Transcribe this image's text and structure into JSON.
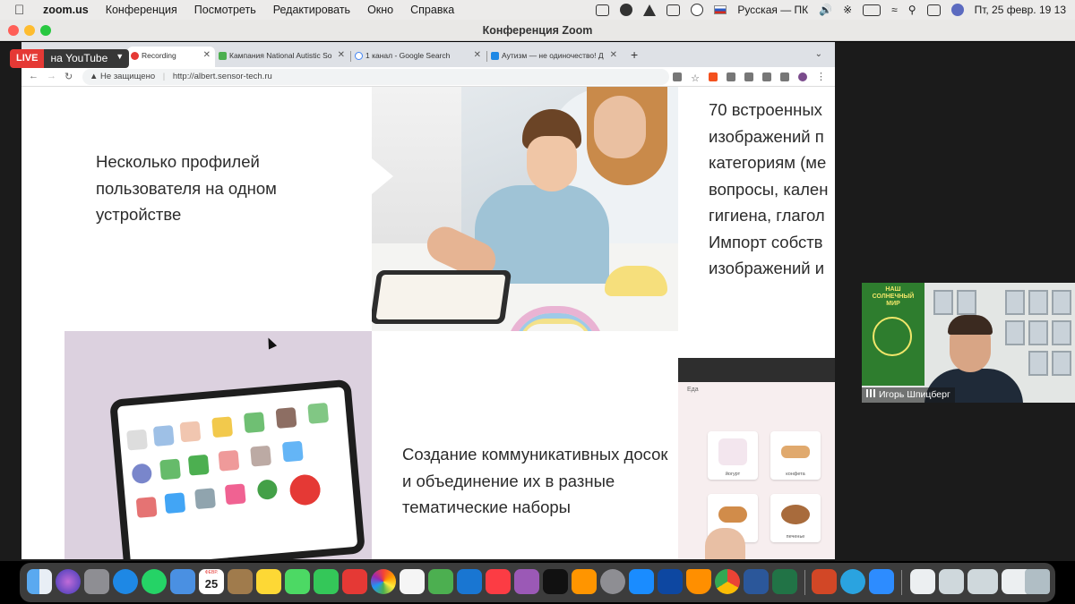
{
  "menubar": {
    "app_name": "zoom.us",
    "items": [
      "Конференция",
      "Посмотреть",
      "Редактировать",
      "Окно",
      "Справка"
    ],
    "input_source": "Русская — ПК",
    "datetime": "Пт, 25 февр.  19 13"
  },
  "zoom_window": {
    "title": "Конференция Zoom"
  },
  "live_badge": {
    "live": "LIVE",
    "target": "на YouTube"
  },
  "browser": {
    "tabs": [
      {
        "label": "Recording",
        "color": "#e53935"
      },
      {
        "label": "Кампания National Autistic So",
        "color": "#4caf50"
      },
      {
        "label": "1 канал - Google Search",
        "color": "#4285f4"
      },
      {
        "label": "Аутизм — не одиночество! Д",
        "color": "#1e88e5"
      }
    ],
    "security": "Не защищено",
    "url": "http://albert.sensor-tech.ru"
  },
  "page": {
    "profiles_text": "Несколько профилей пользователя на одном устройстве",
    "images_lines": [
      "70 встроенных",
      "изображений п",
      "категориям (ме",
      "вопросы, кален",
      "гигиена, глагол",
      "Импорт собств",
      "изображений и"
    ],
    "boards_text": "Создание коммуникативных досок и объединение их в разные тематические наборы",
    "screen_label": "Еда",
    "cards": [
      "йогурт",
      "конфета",
      "хлеб",
      "печенье"
    ]
  },
  "participant": {
    "name": "Игорь Шпицберг",
    "banner": "НАШ СОЛНЕЧНЫЙ МИР"
  },
  "dock": {
    "calendar_month": "ФЕВР.",
    "calendar_day": "25"
  }
}
